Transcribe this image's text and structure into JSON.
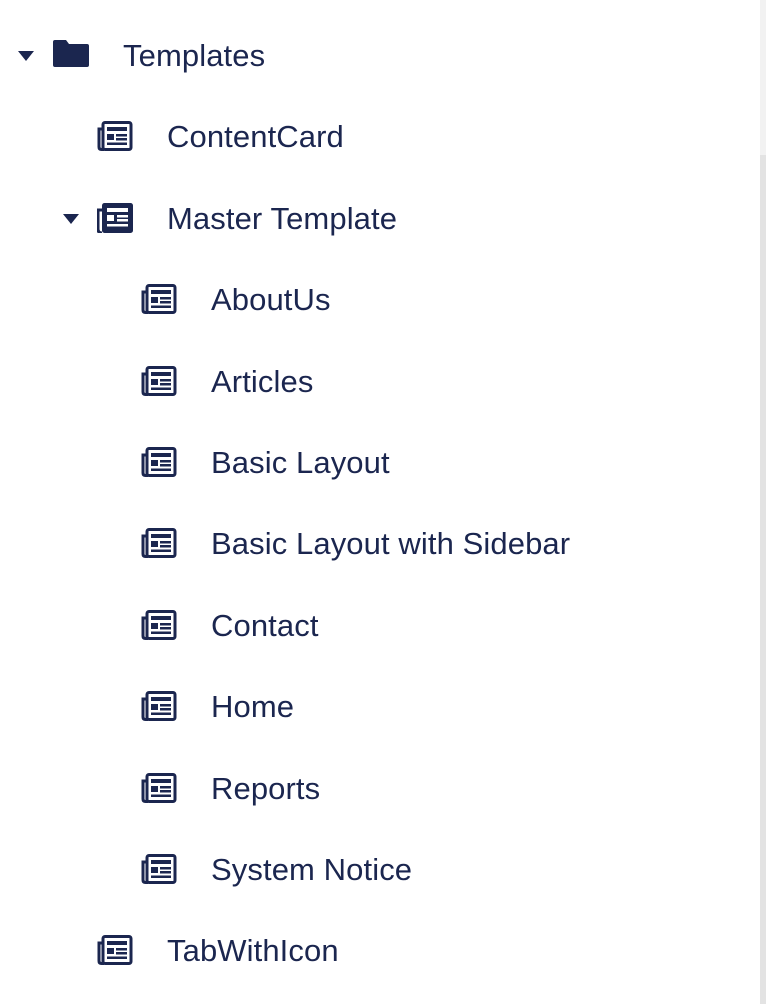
{
  "tree": {
    "root": {
      "label": "Templates",
      "expanded": true,
      "icon": "folder-icon"
    },
    "items": [
      {
        "label": "ContentCard",
        "icon": "template-icon"
      },
      {
        "label": "Master Template",
        "icon": "template-icon",
        "expanded": true,
        "children": [
          {
            "label": "AboutUs",
            "icon": "template-icon"
          },
          {
            "label": "Articles",
            "icon": "template-icon"
          },
          {
            "label": "Basic Layout",
            "icon": "template-icon"
          },
          {
            "label": "Basic Layout with Sidebar",
            "icon": "template-icon"
          },
          {
            "label": "Contact",
            "icon": "template-icon"
          },
          {
            "label": "Home",
            "icon": "template-icon"
          },
          {
            "label": "Reports",
            "icon": "template-icon"
          },
          {
            "label": "System Notice",
            "icon": "template-icon"
          }
        ]
      },
      {
        "label": "TabWithIcon",
        "icon": "template-icon"
      }
    ]
  },
  "colors": {
    "text": "#1b264f",
    "background": "#ffffff",
    "scrollbar": "#e3e3e3"
  }
}
